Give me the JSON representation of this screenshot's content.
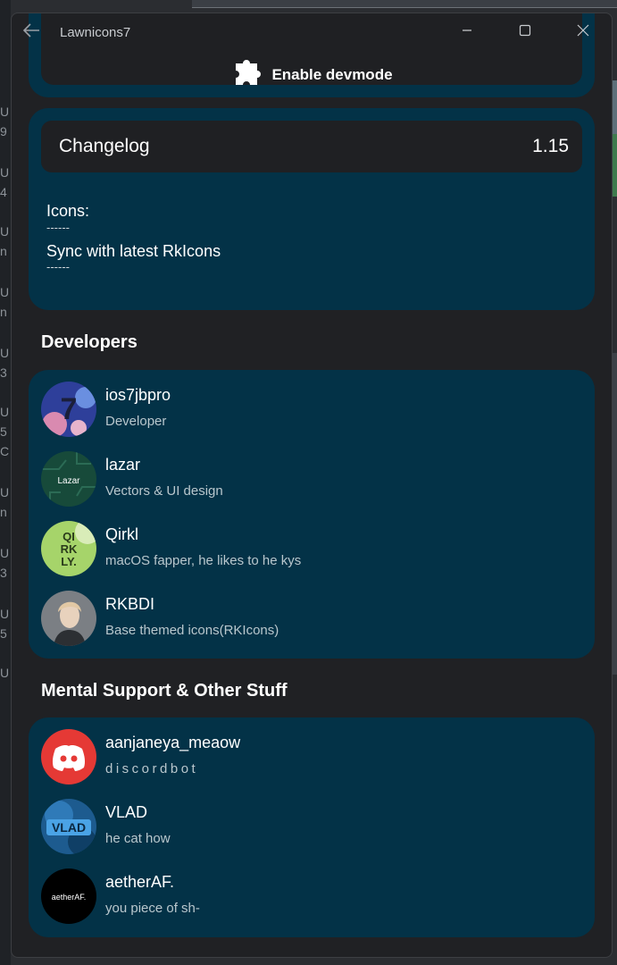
{
  "window": {
    "title": "Lawnicons7"
  },
  "devmode": {
    "label": "Enable devmode"
  },
  "changelog": {
    "title": "Changelog",
    "version": "1.15",
    "lines": [
      "Icons:",
      "------",
      "Sync with latest RkIcons",
      "------"
    ]
  },
  "developers": {
    "heading": "Developers",
    "items": [
      {
        "name": "ios7jbpro",
        "role": "Developer",
        "avatar_text": "7"
      },
      {
        "name": "lazar",
        "role": "Vectors & UI design",
        "avatar_text": "Lazar"
      },
      {
        "name": "Qirkl",
        "role": "macOS fapper, he likes to he kys",
        "avatar_text": "QI RK LY."
      },
      {
        "name": "RKBDI",
        "role": "Base themed icons(RKIcons)",
        "avatar_text": ""
      }
    ]
  },
  "mental": {
    "heading": "Mental Support & Other Stuff",
    "items": [
      {
        "name": "aanjaneya_meaow",
        "role": "discordbot",
        "avatar_text": ""
      },
      {
        "name": "VLAD",
        "role": "he cat how",
        "avatar_text": "VLAD"
      },
      {
        "name": "aetherAF.",
        "role": "you piece of sh-",
        "avatar_text": "aetherAF."
      }
    ]
  },
  "desktop": {
    "left_marks": [
      "U",
      "9",
      "U",
      "4",
      "U",
      "n",
      "U",
      "n",
      "U",
      "3",
      "U",
      "5",
      "C",
      "U",
      "n",
      "U",
      "3",
      "U",
      "5",
      "U"
    ]
  },
  "colors": {
    "card": "#033247",
    "window": "#202124",
    "inner_bar": "#1f2023"
  }
}
